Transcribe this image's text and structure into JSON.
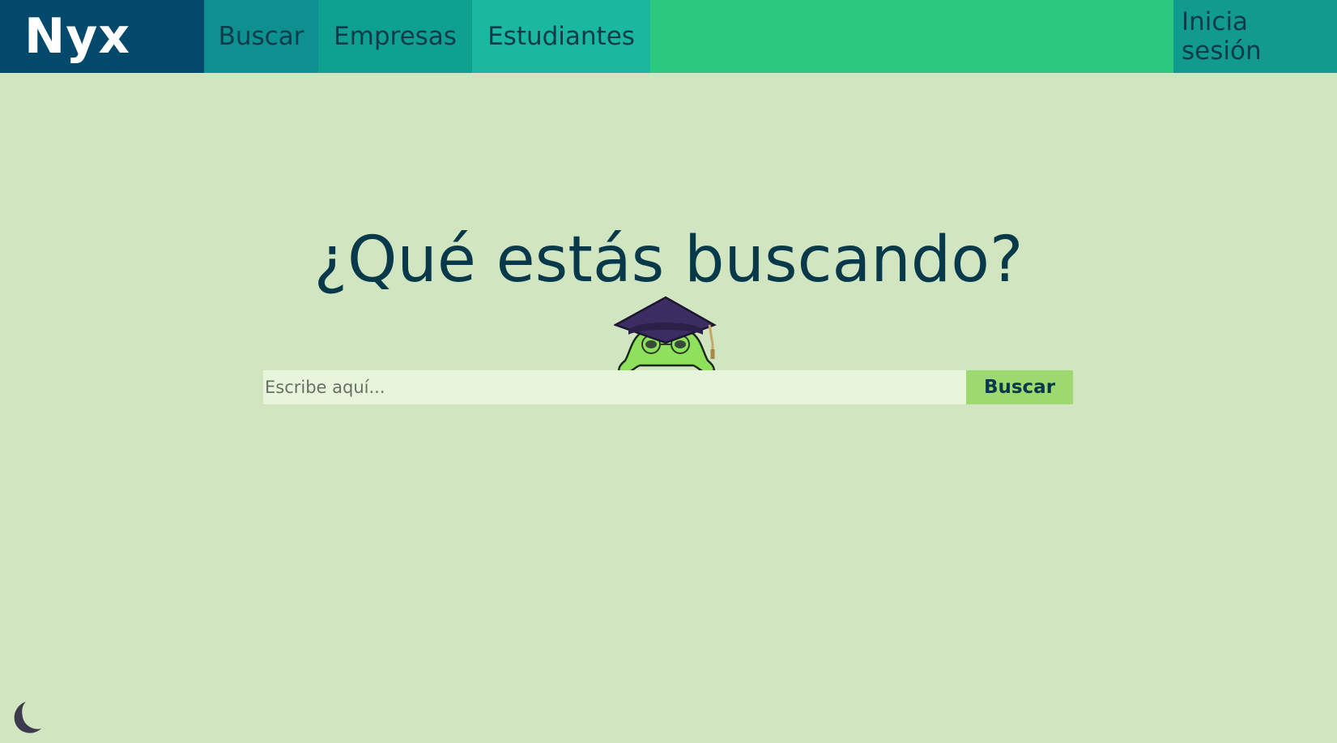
{
  "header": {
    "logo_text": "Nyx",
    "nav": {
      "buscar": "Buscar",
      "empresas": "Empresas",
      "estudiantes": "Estudiantes"
    },
    "login_label": "Inicia sesión"
  },
  "main": {
    "title": "¿Qué estás buscando?",
    "search": {
      "placeholder": "Escribe aquí...",
      "button_label": "Buscar"
    }
  },
  "icons": {
    "mascot": "graduate-frog-mascot-icon",
    "theme_toggle": "moon-icon"
  },
  "colors": {
    "page_bg": "#d2e5c1",
    "navbar_bg": "#2cc880",
    "logo_bg": "#02496c",
    "title_color": "#07394b",
    "search_button_bg": "#9dd96e"
  }
}
